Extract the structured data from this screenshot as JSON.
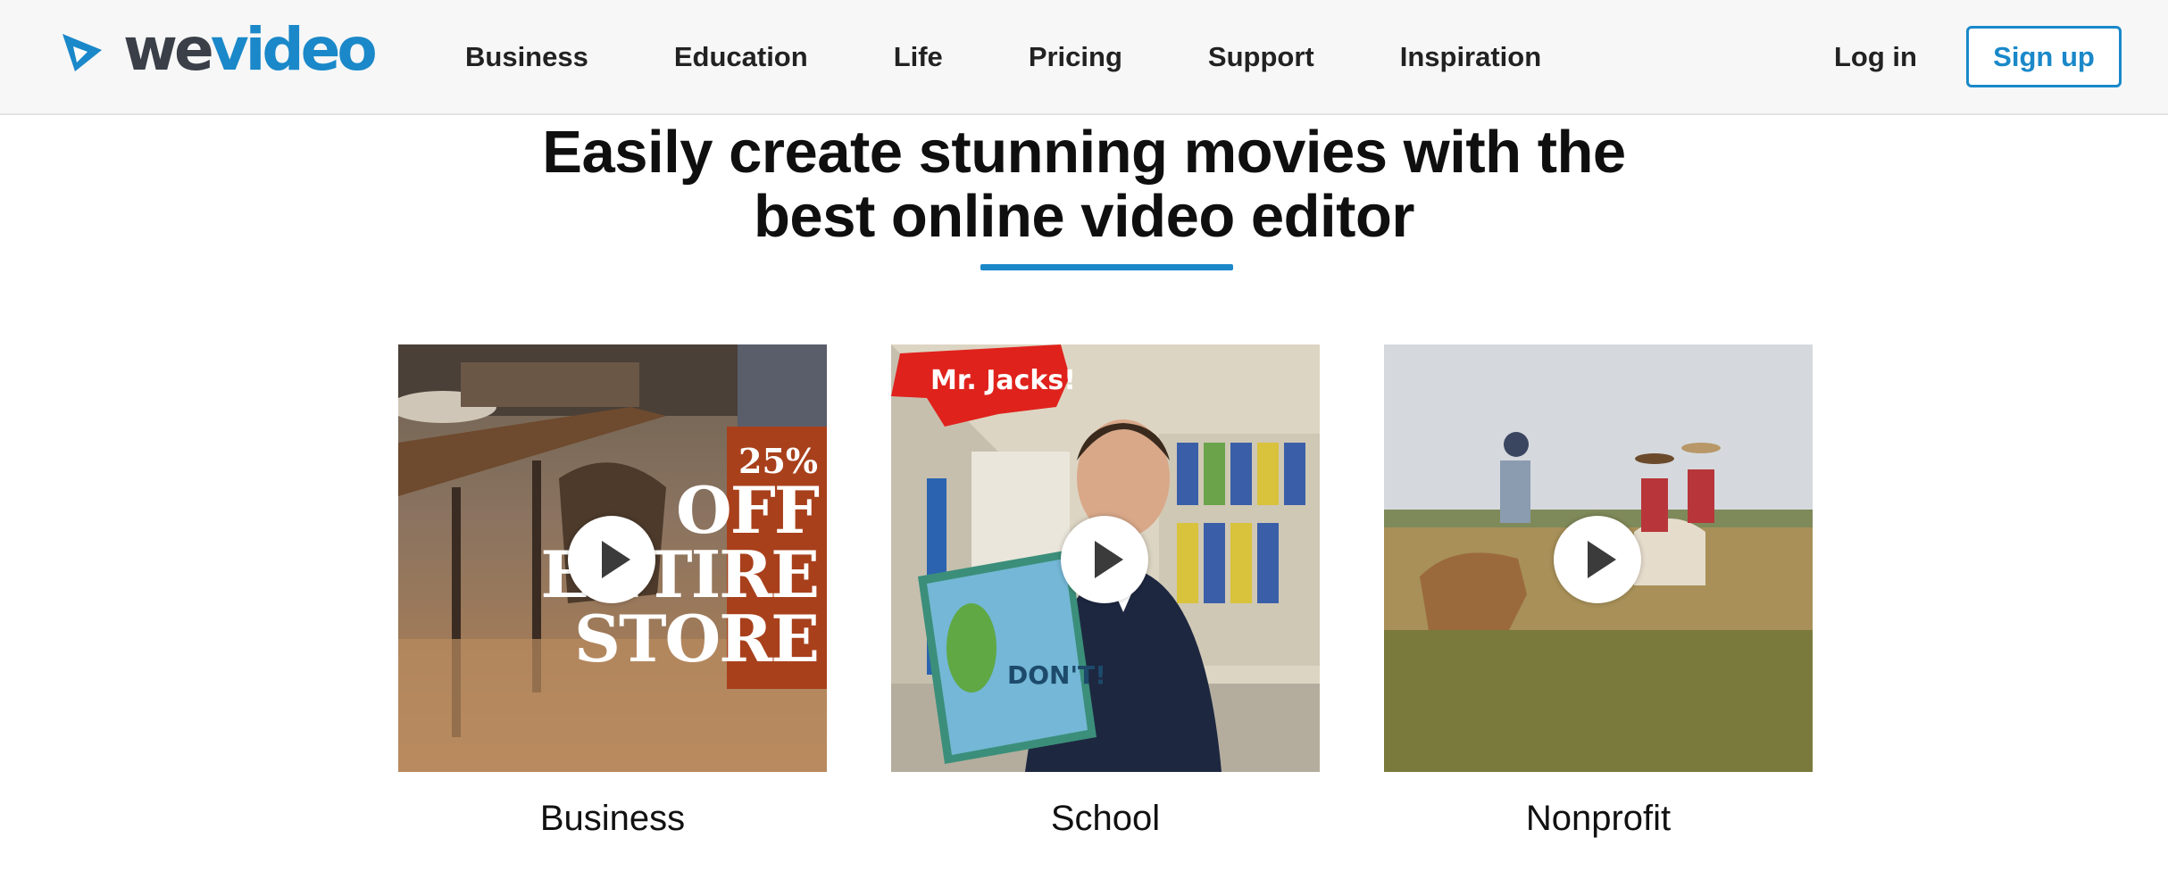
{
  "brand": {
    "logo_we": "we",
    "logo_video": "video",
    "accent": "#1a88c9",
    "dark": "#3a3f48"
  },
  "nav": {
    "items": [
      {
        "label": "Business"
      },
      {
        "label": "Education"
      },
      {
        "label": "Life"
      },
      {
        "label": "Pricing"
      },
      {
        "label": "Support"
      },
      {
        "label": "Inspiration"
      }
    ],
    "login": "Log in",
    "signup": "Sign up"
  },
  "hero": {
    "line1": "Easily create stunning movies with the",
    "line2": "best online video editor"
  },
  "cards": [
    {
      "label": "Business",
      "sale": {
        "percent": "25%",
        "line1": "OFF",
        "line2": "ENTIRE",
        "line3": "STORE"
      }
    },
    {
      "label": "School",
      "banner": "Mr. Jacks!",
      "book_title": "DON'T!"
    },
    {
      "label": "Nonprofit"
    }
  ]
}
